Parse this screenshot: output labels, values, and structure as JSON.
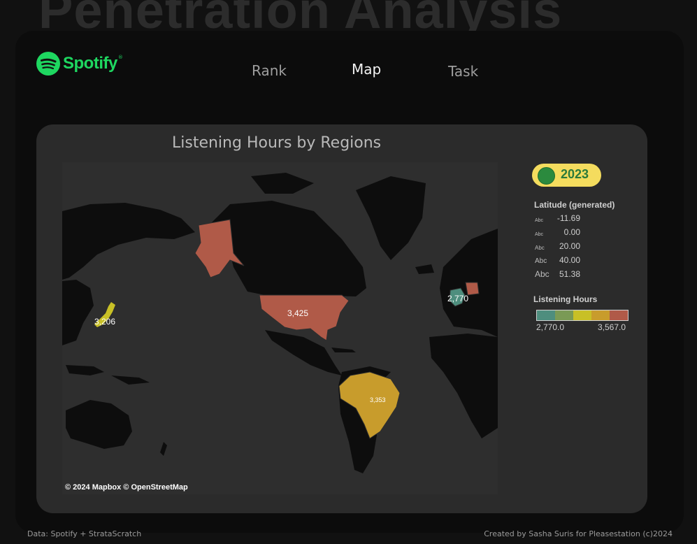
{
  "background_title": "Penetration Analysis",
  "brand": {
    "name": "Spotify",
    "tm": "®",
    "color": "#1ed760"
  },
  "nav": {
    "tabs": [
      {
        "label": "Rank",
        "active": false
      },
      {
        "label": "Map",
        "active": true
      },
      {
        "label": "Task",
        "active": false
      }
    ]
  },
  "card": {
    "title": "Listening Hours by Regions"
  },
  "map": {
    "attribution": "© 2024 Mapbox  © OpenStreetMap",
    "regions": [
      {
        "name": "United States",
        "value": "3,425",
        "color": "#b05a48"
      },
      {
        "name": "Brazil",
        "value": "3,353",
        "color": "#c89c2c"
      },
      {
        "name": "Japan",
        "value": "3,206",
        "color": "#c8c026"
      },
      {
        "name": "Germany",
        "value": "2,770",
        "color": "#4e8e7e"
      }
    ]
  },
  "year_toggle": {
    "label": "2023",
    "knob_color": "#2b8a3e",
    "track_color": "#f4dc5e"
  },
  "latitude_legend": {
    "title": "Latitude (generated)",
    "items": [
      {
        "abc": "Abc",
        "value": "-11.69"
      },
      {
        "abc": "Abc",
        "value": "0.00"
      },
      {
        "abc": "Abc",
        "value": "20.00"
      },
      {
        "abc": "Abc",
        "value": "40.00"
      },
      {
        "abc": "Abc",
        "value": "51.38"
      }
    ]
  },
  "hours_legend": {
    "title": "Listening Hours",
    "min": "2,770.0",
    "max": "3,567.0",
    "colors": [
      "#4e8e7e",
      "#7a9a55",
      "#c8c026",
      "#c89c2c",
      "#b05a48"
    ]
  },
  "footer": {
    "left": "Data: Spotify + StrataScratch",
    "right": "Created by Sasha Suris for Pleasestation (c)2024"
  }
}
